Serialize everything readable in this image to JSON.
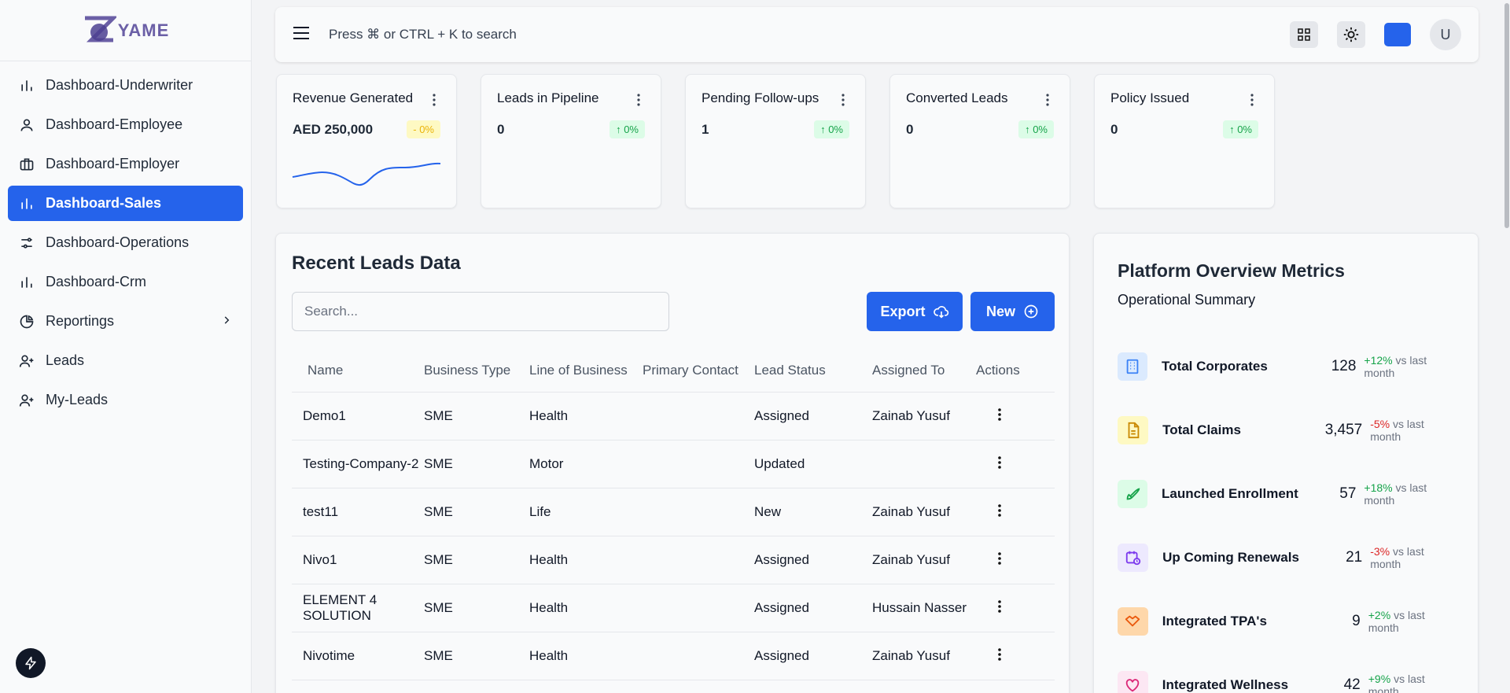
{
  "brand": {
    "name": "YAME",
    "letter": "Z"
  },
  "sidebar": {
    "items": [
      {
        "label": "Dashboard-Underwriter",
        "icon": "bar-chart-icon",
        "active": false
      },
      {
        "label": "Dashboard-Employee",
        "icon": "user-icon",
        "active": false
      },
      {
        "label": "Dashboard-Employer",
        "icon": "briefcase-icon",
        "active": false
      },
      {
        "label": "Dashboard-Sales",
        "icon": "bar-chart-icon",
        "active": true
      },
      {
        "label": "Dashboard-Operations",
        "icon": "sliders-icon",
        "active": false
      },
      {
        "label": "Dashboard-Crm",
        "icon": "bar-chart-icon",
        "active": false
      },
      {
        "label": "Reportings",
        "icon": "pie-chart-icon",
        "active": false
      },
      {
        "label": "Leads",
        "icon": "user-plus-icon",
        "active": false
      },
      {
        "label": "My-Leads",
        "icon": "user-plus-icon",
        "active": false
      }
    ]
  },
  "topbar": {
    "search_hint": "Press ⌘ or CTRL + K to search",
    "avatar_initial": "U"
  },
  "stats": [
    {
      "title": "Revenue Generated",
      "value": "AED 250,000",
      "badge": "- 0%",
      "tone": "warn"
    },
    {
      "title": "Leads in Pipeline",
      "value": "0",
      "badge": "↑ 0%",
      "tone": "up"
    },
    {
      "title": "Pending Follow-ups",
      "value": "1",
      "badge": "↑ 0%",
      "tone": "up"
    },
    {
      "title": "Converted Leads",
      "value": "0",
      "badge": "↑ 0%",
      "tone": "up"
    },
    {
      "title": "Policy Issued",
      "value": "0",
      "badge": "↑ 0%",
      "tone": "up"
    }
  ],
  "leads": {
    "title": "Recent Leads Data",
    "search_placeholder": "Search...",
    "export_label": "Export",
    "new_label": "New",
    "columns": [
      "Name",
      "Business Type",
      "Line of Business",
      "Primary Contact",
      "Lead Status",
      "Assigned To",
      "Actions"
    ],
    "rows": [
      {
        "name": "Demo1",
        "type": "SME",
        "lob": "Health",
        "contact": "",
        "status": "Assigned",
        "assigned": "Zainab Yusuf"
      },
      {
        "name": "Testing-Company-2",
        "type": "SME",
        "lob": "Motor",
        "contact": "",
        "status": "Updated",
        "assigned": ""
      },
      {
        "name": "test11",
        "type": "SME",
        "lob": "Life",
        "contact": "",
        "status": "New",
        "assigned": "Zainab Yusuf"
      },
      {
        "name": "Nivo1",
        "type": "SME",
        "lob": "Health",
        "contact": "",
        "status": "Assigned",
        "assigned": "Zainab Yusuf"
      },
      {
        "name": "ELEMENT 4 SOLUTION",
        "type": "SME",
        "lob": "Health",
        "contact": "",
        "status": "Assigned",
        "assigned": "Hussain Nasser"
      },
      {
        "name": "Nivotime",
        "type": "SME",
        "lob": "Health",
        "contact": "",
        "status": "Assigned",
        "assigned": "Zainab Yusuf"
      }
    ]
  },
  "metrics": {
    "title": "Platform Overview Metrics",
    "subtitle": "Operational Summary",
    "items": [
      {
        "label": "Total Corporates",
        "value": "128",
        "delta": "+12%",
        "dir": "up",
        "suffix": "vs last month",
        "icon": "building-icon",
        "bg": "#dbeafe",
        "fg": "#3b82f6"
      },
      {
        "label": "Total Claims",
        "value": "3,457",
        "delta": "-5%",
        "dir": "down",
        "suffix": "vs last month",
        "icon": "file-text-icon",
        "bg": "#fef9c3",
        "fg": "#ca8a04"
      },
      {
        "label": "Launched Enrollment",
        "value": "57",
        "delta": "+18%",
        "dir": "up",
        "suffix": "vs last month",
        "icon": "rocket-icon",
        "bg": "#dcfce7",
        "fg": "#16a34a"
      },
      {
        "label": "Up Coming Renewals",
        "value": "21",
        "delta": "-3%",
        "dir": "down",
        "suffix": "vs last month",
        "icon": "calendar-clock-icon",
        "bg": "#ede9fe",
        "fg": "#7c3aed"
      },
      {
        "label": "Integrated TPA's",
        "value": "9",
        "delta": "+2%",
        "dir": "up",
        "suffix": "vs last month",
        "icon": "handshake-icon",
        "bg": "#fed7aa",
        "fg": "#ea580c"
      },
      {
        "label": "Integrated Wellness",
        "value": "42",
        "delta": "+9%",
        "dir": "up",
        "suffix": "vs last month",
        "icon": "heart-pulse-icon",
        "bg": "#fce7f3",
        "fg": "#db2777"
      }
    ]
  },
  "colors": {
    "accent": "#2563eb",
    "up": "#16a34a",
    "down": "#dc2626",
    "warn": "#eab308"
  }
}
